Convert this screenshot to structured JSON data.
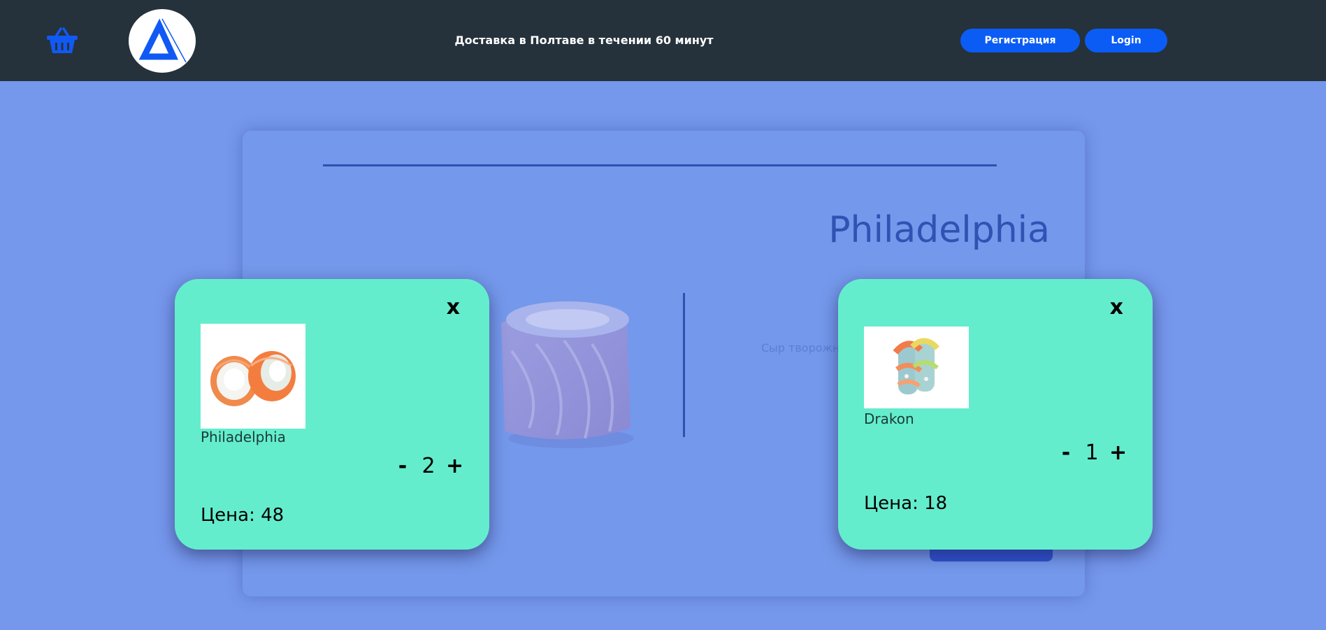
{
  "header": {
    "tagline": "Доставка в Полтаве в течении 60 минут",
    "register_label": "Регистрация",
    "login_label": "Login",
    "cart_icon": "basket-icon",
    "logo": "triangle-logo"
  },
  "product_panel": {
    "title": "Philadelphia",
    "description_fragment": "Сыр творожн"
  },
  "cart_items": [
    {
      "name": "Philadelphia",
      "quantity": "2",
      "price_text": "Цена: 48",
      "close": "x",
      "minus": "-",
      "plus": "+"
    },
    {
      "name": "Drakon",
      "quantity": "1",
      "price_text": "Цена: 18",
      "close": "x",
      "minus": "-",
      "plus": "+"
    }
  ],
  "colors": {
    "header_bg": "#25323b",
    "page_bg": "#7597ec",
    "accent_button": "#0b5cf5",
    "card_bg": "#64edcd",
    "title_color": "#2f52b3"
  }
}
